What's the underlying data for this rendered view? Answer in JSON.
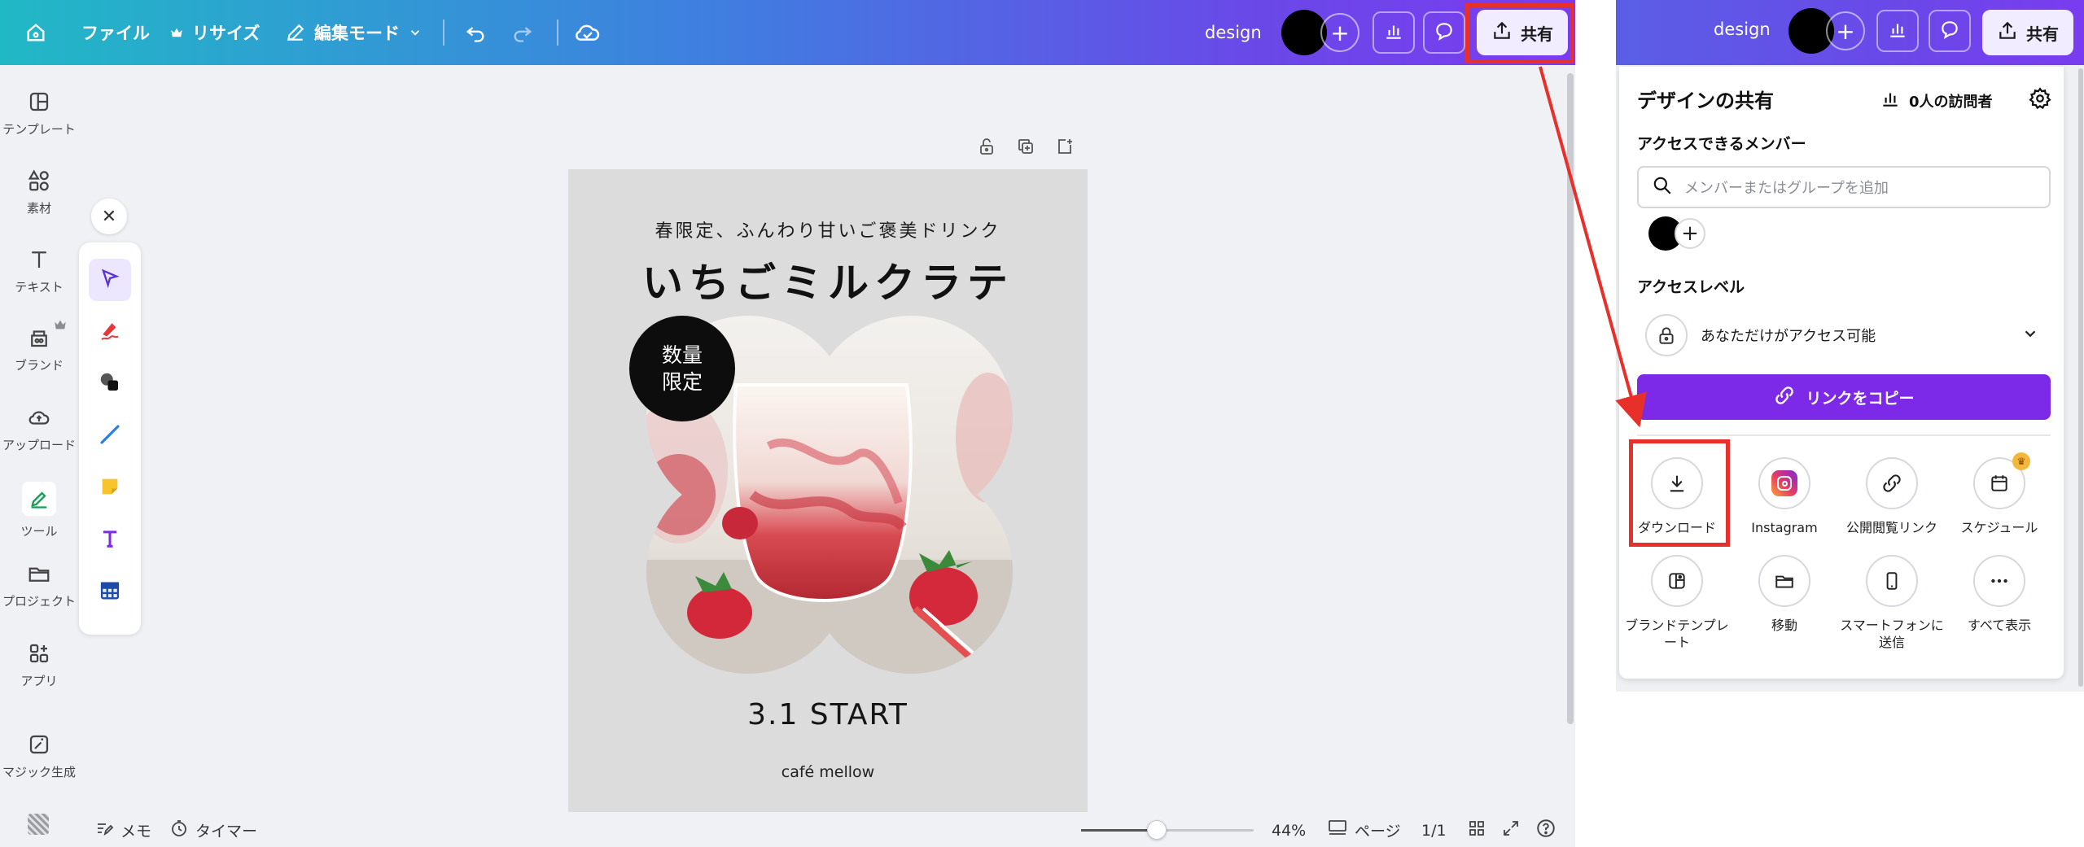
{
  "editor": {
    "topbar": {
      "home_icon": "home-icon",
      "file_label": "ファイル",
      "resize_label": "リサイズ",
      "edit_mode_label": "編集モード",
      "design_name": "design",
      "share_label": "共有"
    },
    "sidebar": {
      "items": [
        {
          "label": "テンプレート",
          "icon": "template-icon"
        },
        {
          "label": "素材",
          "icon": "elements-icon"
        },
        {
          "label": "テキスト",
          "icon": "text-icon"
        },
        {
          "label": "ブランド",
          "icon": "brand-icon"
        },
        {
          "label": "アップロード",
          "icon": "upload-icon"
        },
        {
          "label": "ツール",
          "icon": "tools-icon"
        },
        {
          "label": "プロジェクト",
          "icon": "folder-icon"
        },
        {
          "label": "アプリ",
          "icon": "apps-icon"
        },
        {
          "label": "マジック生成",
          "icon": "magic-icon"
        }
      ]
    },
    "palette": {
      "close_icon": "close-icon",
      "tools": [
        "select-icon",
        "pen-icon",
        "shapes-icon",
        "line-icon",
        "sticky-note-icon",
        "text-tool-icon",
        "table-icon"
      ]
    },
    "poster": {
      "subtitle": "春限定、ふんわり甘いご褒美ドリンク",
      "title": "いちごミルクラテ",
      "badge_line1": "数量",
      "badge_line2": "限定",
      "start_text": "3.1 START",
      "brand": "café mellow"
    },
    "bottombar": {
      "notes_label": "メモ",
      "timer_label": "タイマー",
      "zoom_value": 44,
      "zoom_label": "44%",
      "pages_label": "ページ",
      "page_count": "1/1"
    }
  },
  "share": {
    "topbar": {
      "design_name": "design",
      "share_label": "共有"
    },
    "panel": {
      "title": "デザインの共有",
      "visitors": "0人の訪問者",
      "members_label": "アクセスできるメンバー",
      "search_placeholder": "メンバーまたはグループを追加",
      "access_label": "アクセスレベル",
      "access_value": "あなただけがアクセス可能",
      "copy_link_label": "リンクをコピー",
      "options": [
        {
          "label": "ダウンロード",
          "icon": "download-icon"
        },
        {
          "label": "Instagram",
          "icon": "instagram-icon"
        },
        {
          "label": "公開閲覧リンク",
          "icon": "link-icon"
        },
        {
          "label": "スケジュール",
          "icon": "calendar-icon"
        },
        {
          "label": "ブランドテンプレート",
          "icon": "brand-template-icon"
        },
        {
          "label": "移動",
          "icon": "folder-move-icon"
        },
        {
          "label": "スマートフォンに送信",
          "icon": "phone-icon"
        },
        {
          "label": "すべて表示",
          "icon": "more-icon"
        }
      ]
    }
  },
  "colors": {
    "accent_purple": "#7d2ae8",
    "highlight_red": "#e8302a"
  }
}
